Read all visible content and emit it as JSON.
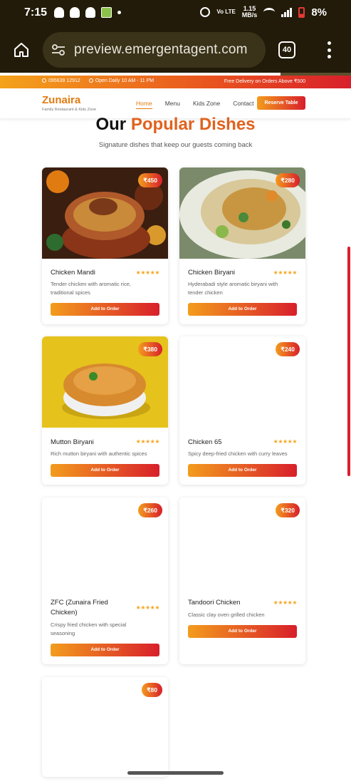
{
  "status_bar": {
    "time": "7:15",
    "network": "Vo LTE",
    "speed_value": "1.15",
    "speed_unit": "MB/s",
    "battery": "8%"
  },
  "browser": {
    "url": "preview.emergentagent.com",
    "tab_count": "40",
    "load_progress": 0.8
  },
  "site": {
    "phone": "095639 12912",
    "hours": "Open Daily 10 AM - 11 PM",
    "promo": "Free Delivery on Orders Above ₹500",
    "brand": "Zunaira",
    "tagline": "Family Restaurant & Kids Zone",
    "nav": [
      "Home",
      "Menu",
      "Kids Zone",
      "Contact"
    ],
    "reserve_label": "Reserve Table",
    "section_title_a": "Our ",
    "section_title_b": "Popular Dishes",
    "section_subtitle": "Signature dishes that keep our guests coming back"
  },
  "colors": {
    "accent_orange": "#f39c1d",
    "accent_red": "#d81f2b",
    "brand": "#e07b12"
  },
  "dishes": [
    {
      "name": "Chicken Mandi",
      "price": "₹450",
      "stars": "★★★★★",
      "desc": "Tender chicken with aromatic rice, traditional spices",
      "button": "Add to Order",
      "image": "mandi"
    },
    {
      "name": "Chicken Biryani",
      "price": "₹280",
      "stars": "★★★★★",
      "desc": "Hyderabadi style aromatic biryani with tender chicken",
      "button": "Add to Order",
      "image": "biryani"
    },
    {
      "name": "Mutton Biryani",
      "price": "₹380",
      "stars": "★★★★★",
      "desc": "Rich mutton biryani with authentic spices",
      "button": "Add to Order",
      "image": "mutton"
    },
    {
      "name": "Chicken 65",
      "price": "₹240",
      "stars": "★★★★★",
      "desc": "Spicy deep-fried chicken with curry leaves",
      "button": "Add to Order",
      "image": "blank"
    },
    {
      "name": "ZFC (Zunaira Fried Chicken)",
      "price": "₹260",
      "stars": "★★★★★",
      "desc": "Crispy fried chicken with special seasoning",
      "button": "Add to Order",
      "image": "blank"
    },
    {
      "name": "Tandoori Chicken",
      "price": "₹320",
      "stars": "★★★★★",
      "desc": "Classic clay oven grilled chicken",
      "button": "Add to Order",
      "image": "blank"
    },
    {
      "price": "₹80",
      "image": "blank"
    }
  ]
}
